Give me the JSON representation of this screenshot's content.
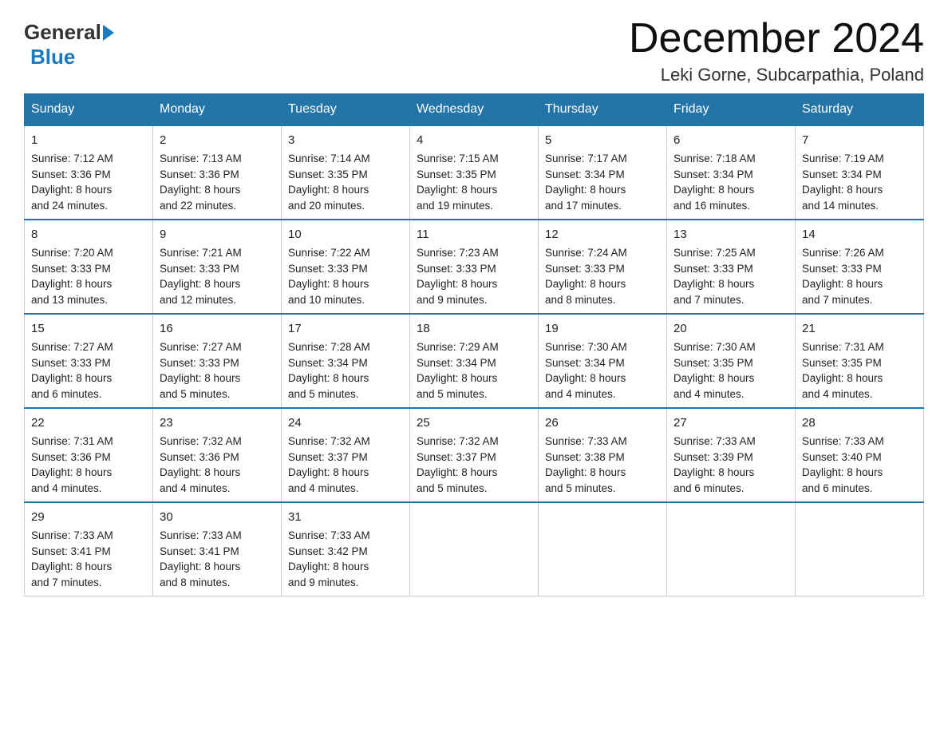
{
  "logo": {
    "part1": "General",
    "part2": "Blue"
  },
  "title": "December 2024",
  "location": "Leki Gorne, Subcarpathia, Poland",
  "days_of_week": [
    "Sunday",
    "Monday",
    "Tuesday",
    "Wednesday",
    "Thursday",
    "Friday",
    "Saturday"
  ],
  "weeks": [
    [
      {
        "day": "1",
        "sunrise": "7:12 AM",
        "sunset": "3:36 PM",
        "daylight": "8 hours and 24 minutes."
      },
      {
        "day": "2",
        "sunrise": "7:13 AM",
        "sunset": "3:36 PM",
        "daylight": "8 hours and 22 minutes."
      },
      {
        "day": "3",
        "sunrise": "7:14 AM",
        "sunset": "3:35 PM",
        "daylight": "8 hours and 20 minutes."
      },
      {
        "day": "4",
        "sunrise": "7:15 AM",
        "sunset": "3:35 PM",
        "daylight": "8 hours and 19 minutes."
      },
      {
        "day": "5",
        "sunrise": "7:17 AM",
        "sunset": "3:34 PM",
        "daylight": "8 hours and 17 minutes."
      },
      {
        "day": "6",
        "sunrise": "7:18 AM",
        "sunset": "3:34 PM",
        "daylight": "8 hours and 16 minutes."
      },
      {
        "day": "7",
        "sunrise": "7:19 AM",
        "sunset": "3:34 PM",
        "daylight": "8 hours and 14 minutes."
      }
    ],
    [
      {
        "day": "8",
        "sunrise": "7:20 AM",
        "sunset": "3:33 PM",
        "daylight": "8 hours and 13 minutes."
      },
      {
        "day": "9",
        "sunrise": "7:21 AM",
        "sunset": "3:33 PM",
        "daylight": "8 hours and 12 minutes."
      },
      {
        "day": "10",
        "sunrise": "7:22 AM",
        "sunset": "3:33 PM",
        "daylight": "8 hours and 10 minutes."
      },
      {
        "day": "11",
        "sunrise": "7:23 AM",
        "sunset": "3:33 PM",
        "daylight": "8 hours and 9 minutes."
      },
      {
        "day": "12",
        "sunrise": "7:24 AM",
        "sunset": "3:33 PM",
        "daylight": "8 hours and 8 minutes."
      },
      {
        "day": "13",
        "sunrise": "7:25 AM",
        "sunset": "3:33 PM",
        "daylight": "8 hours and 7 minutes."
      },
      {
        "day": "14",
        "sunrise": "7:26 AM",
        "sunset": "3:33 PM",
        "daylight": "8 hours and 7 minutes."
      }
    ],
    [
      {
        "day": "15",
        "sunrise": "7:27 AM",
        "sunset": "3:33 PM",
        "daylight": "8 hours and 6 minutes."
      },
      {
        "day": "16",
        "sunrise": "7:27 AM",
        "sunset": "3:33 PM",
        "daylight": "8 hours and 5 minutes."
      },
      {
        "day": "17",
        "sunrise": "7:28 AM",
        "sunset": "3:34 PM",
        "daylight": "8 hours and 5 minutes."
      },
      {
        "day": "18",
        "sunrise": "7:29 AM",
        "sunset": "3:34 PM",
        "daylight": "8 hours and 5 minutes."
      },
      {
        "day": "19",
        "sunrise": "7:30 AM",
        "sunset": "3:34 PM",
        "daylight": "8 hours and 4 minutes."
      },
      {
        "day": "20",
        "sunrise": "7:30 AM",
        "sunset": "3:35 PM",
        "daylight": "8 hours and 4 minutes."
      },
      {
        "day": "21",
        "sunrise": "7:31 AM",
        "sunset": "3:35 PM",
        "daylight": "8 hours and 4 minutes."
      }
    ],
    [
      {
        "day": "22",
        "sunrise": "7:31 AM",
        "sunset": "3:36 PM",
        "daylight": "8 hours and 4 minutes."
      },
      {
        "day": "23",
        "sunrise": "7:32 AM",
        "sunset": "3:36 PM",
        "daylight": "8 hours and 4 minutes."
      },
      {
        "day": "24",
        "sunrise": "7:32 AM",
        "sunset": "3:37 PM",
        "daylight": "8 hours and 4 minutes."
      },
      {
        "day": "25",
        "sunrise": "7:32 AM",
        "sunset": "3:37 PM",
        "daylight": "8 hours and 5 minutes."
      },
      {
        "day": "26",
        "sunrise": "7:33 AM",
        "sunset": "3:38 PM",
        "daylight": "8 hours and 5 minutes."
      },
      {
        "day": "27",
        "sunrise": "7:33 AM",
        "sunset": "3:39 PM",
        "daylight": "8 hours and 6 minutes."
      },
      {
        "day": "28",
        "sunrise": "7:33 AM",
        "sunset": "3:40 PM",
        "daylight": "8 hours and 6 minutes."
      }
    ],
    [
      {
        "day": "29",
        "sunrise": "7:33 AM",
        "sunset": "3:41 PM",
        "daylight": "8 hours and 7 minutes."
      },
      {
        "day": "30",
        "sunrise": "7:33 AM",
        "sunset": "3:41 PM",
        "daylight": "8 hours and 8 minutes."
      },
      {
        "day": "31",
        "sunrise": "7:33 AM",
        "sunset": "3:42 PM",
        "daylight": "8 hours and 9 minutes."
      },
      null,
      null,
      null,
      null
    ]
  ],
  "labels": {
    "sunrise": "Sunrise:",
    "sunset": "Sunset:",
    "daylight": "Daylight:"
  }
}
